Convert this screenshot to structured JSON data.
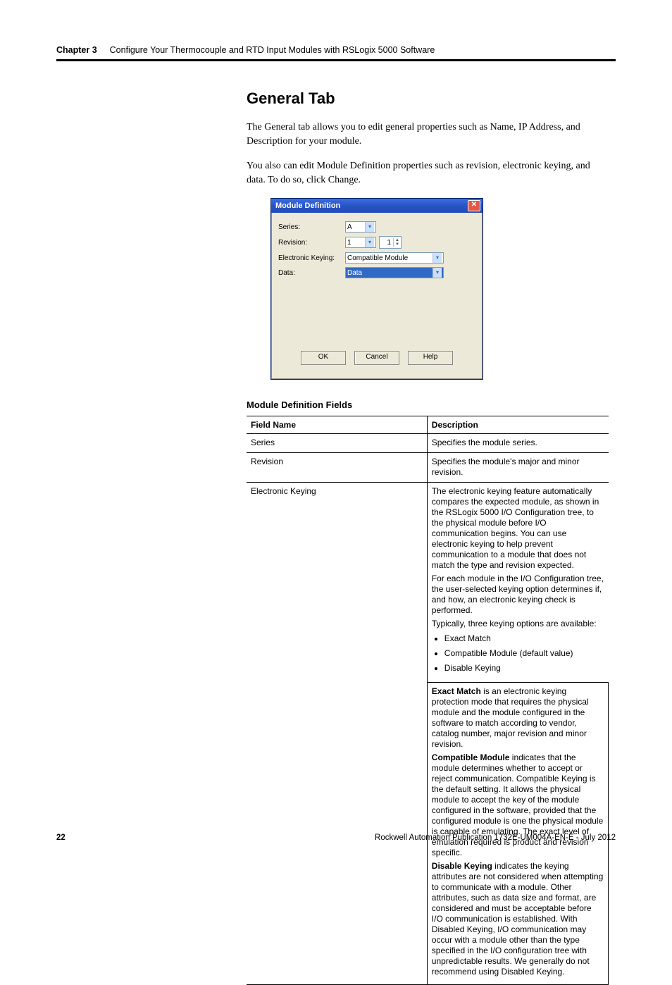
{
  "header": {
    "chapter_label": "Chapter 3",
    "chapter_title": "Configure Your Thermocouple and RTD Input Modules with RSLogix 5000 Software"
  },
  "section_heading": "General Tab",
  "para1": "The General tab allows you to edit general properties such as Name, IP Address, and Description for your module.",
  "para2": "You also can edit Module Definition properties such as revision, electronic keying, and data. To do so, click Change.",
  "dialog": {
    "title": "Module Definition",
    "labels": {
      "series": "Series:",
      "revision": "Revision:",
      "ek": "Electronic Keying:",
      "data": "Data:"
    },
    "values": {
      "series": "A",
      "rev_major": "1",
      "rev_minor": "1",
      "ek": "Compatible Module",
      "data": "Data"
    },
    "buttons": {
      "ok": "OK",
      "cancel": "Cancel",
      "help": "Help"
    }
  },
  "table": {
    "title": "Module Definition Fields",
    "headers": {
      "field": "Field Name",
      "desc": "Description"
    },
    "rows": {
      "series": {
        "name": "Series",
        "desc": "Specifies the module series."
      },
      "revision": {
        "name": "Revision",
        "desc": "Specifies the module's major and minor revision."
      },
      "ek": {
        "name": "Electronic Keying",
        "p1": "The electronic keying feature automatically compares the expected module, as shown in the RSLogix 5000 I/O Configuration tree, to the physical module before I/O communication begins. You can use electronic keying to help prevent communication to a module that does not match the type and revision expected.",
        "p2": "For each module in the I/O Configuration tree, the user-selected keying option determines if, and how, an electronic keying check is performed.",
        "p3": "Typically, three keying options are available:",
        "bullets": [
          "Exact Match",
          "Compatible Module (default value)",
          "Disable Keying"
        ],
        "exact_strong": "Exact Match",
        "exact_rest": " is an electronic keying protection mode that requires the physical module and the module configured in the software to match according to vendor, catalog number, major revision and minor revision.",
        "compat_strong": "Compatible Module",
        "compat_rest": " indicates that the module determines whether to accept or reject communication. Compatible Keying is the default setting. It allows the physical module to accept the key of the module configured in the software, provided that the configured module is one the physical module is capable of emulating. The exact level of emulation required is product and revision specific.",
        "disable_strong": "Disable Keying",
        "disable_rest": " indicates the keying attributes are not considered when attempting to communicate with a module. Other attributes, such as data size and format, are considered and must be acceptable before I/O communication is established. With Disabled Keying, I/O communication may occur with a module other than the type specified in the I/O configuration tree with unpredictable results. We generally do not recommend using Disabled Keying."
      }
    }
  },
  "footer": {
    "page": "22",
    "pub": "Rockwell Automation Publication 1732E-UM004A-EN-E - July 2012"
  }
}
